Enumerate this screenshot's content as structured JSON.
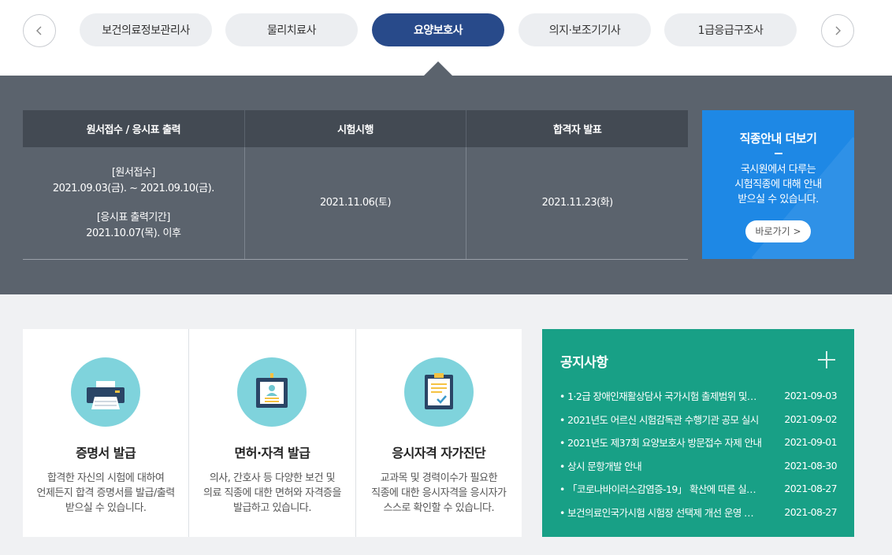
{
  "tabs": [
    {
      "label": "보건의료정보관리사",
      "active": false
    },
    {
      "label": "물리치료사",
      "active": false
    },
    {
      "label": "요양보호사",
      "active": true
    },
    {
      "label": "의지·보조기기사",
      "active": false
    },
    {
      "label": "1급응급구조사",
      "active": false
    }
  ],
  "icons": {
    "prev": "chevron-left-icon",
    "next": "chevron-right-icon"
  },
  "schedule": {
    "headers": [
      "원서접수 / 응시표 출력",
      "시험시행",
      "합격자 발표"
    ],
    "application_label": "[원서접수]",
    "application_period": "2021.09.03(금). ~ 2021.09.10(금).",
    "print_label": "[응시표 출력기간]",
    "print_period": "2021.10.07(목). 이후",
    "exam_date": "2021.11.06(토)",
    "result_date": "2021.11.23(화)"
  },
  "more_info": {
    "title": "직종안내 더보기",
    "desc_line1": "국시원에서 다루는",
    "desc_line2": "시험직종에 대해 안내",
    "desc_line3": "받으실 수 있습니다.",
    "button": "바로가기 >"
  },
  "cards": [
    {
      "title": "증명서 발급",
      "desc1": "합격한 자신의 시험에 대하여",
      "desc2": "언제든지 합격 증명서를 발급/출력",
      "desc3": "받으실 수 있습니다.",
      "icon": "printer-icon"
    },
    {
      "title": "면허·자격 발급",
      "desc1": "의사, 간호사 등 다양한 보건 및",
      "desc2": "의료 직종에 대한 면허와 자격증을",
      "desc3": "발급하고 있습니다.",
      "icon": "id-badge-icon"
    },
    {
      "title": "응시자격 자가진단",
      "desc1": "교과목 및 경력이수가 필요한",
      "desc2": "직종에 대한 응시자격을 응시자가",
      "desc3": "스스로 확인할 수 있습니다.",
      "icon": "clipboard-check-icon"
    }
  ],
  "notice": {
    "title": "공지사항",
    "more_icon": "plus-icon",
    "items": [
      {
        "title": "1·2급 장애인재활상담사 국가시험 출제범위 및…",
        "date": "2021-09-03"
      },
      {
        "title": "2021년도 어르신 시험감독관 수행기관 공모 실시",
        "date": "2021-09-02"
      },
      {
        "title": "2021년도 제37회 요양보호사 방문접수 자제 안내",
        "date": "2021-09-01"
      },
      {
        "title": "상시 문항개발 안내",
        "date": "2021-08-30"
      },
      {
        "title": "「코로나바이러스감염증-19」 확산에 따른 실…",
        "date": "2021-08-27"
      },
      {
        "title": "보건의료인국가시험 시험장 선택제 개선 운영 …",
        "date": "2021-08-27"
      }
    ]
  }
}
